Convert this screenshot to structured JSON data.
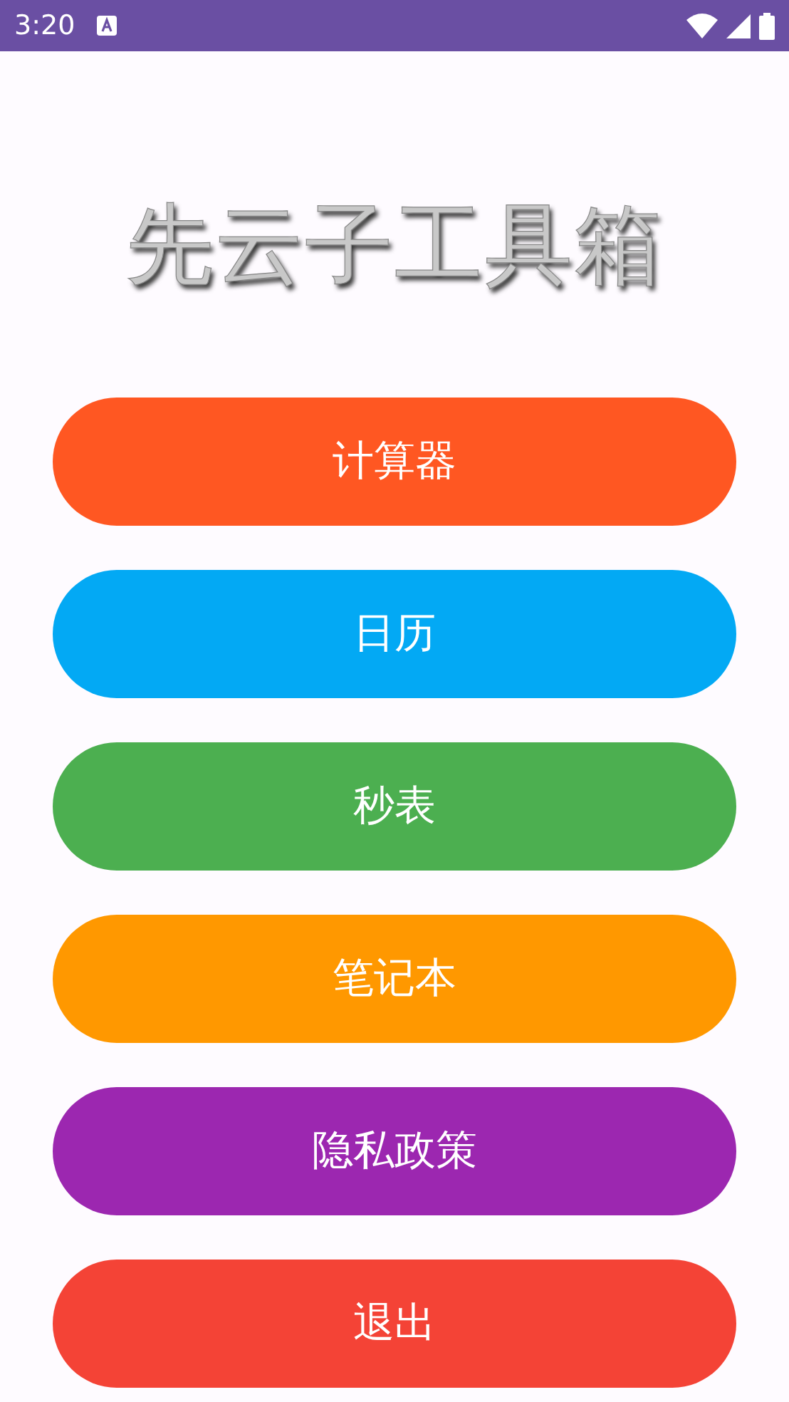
{
  "status_bar": {
    "time": "3:20"
  },
  "title": "先云子工具箱",
  "buttons": [
    {
      "label": "计算器",
      "color": "#ff5722"
    },
    {
      "label": "日历",
      "color": "#03a9f4"
    },
    {
      "label": "秒表",
      "color": "#4caf50"
    },
    {
      "label": "笔记本",
      "color": "#ff9800"
    },
    {
      "label": "隐私政策",
      "color": "#9c27b0"
    },
    {
      "label": "退出",
      "color": "#f44336"
    }
  ]
}
